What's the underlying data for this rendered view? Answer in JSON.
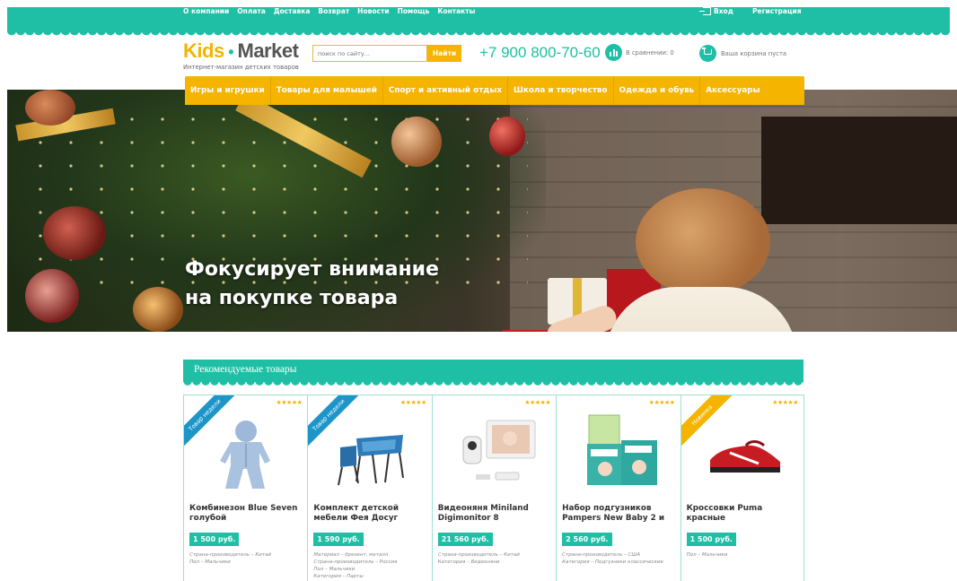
{
  "topbar": {
    "nav": [
      "О компании",
      "Оплата",
      "Доставка",
      "Возврат",
      "Новости",
      "Помощь",
      "Контакты"
    ],
    "login": "Вход",
    "register": "Регистрация"
  },
  "header": {
    "logo_kids": "Kids",
    "logo_market": "Market",
    "tagline": "Интернет-магазин детских товаров",
    "search_placeholder": "поиск по сайту...",
    "search_button": "Найти",
    "phone": "+7 900 800-70-60",
    "compare": "В сравнении: 0",
    "cart": "Ваша корзина пуста"
  },
  "categories": [
    "Игры и игрушки",
    "Товары для малышей",
    "Спорт и активный отдых",
    "Школа и творчество",
    "Одежда и обувь",
    "Аксессуары"
  ],
  "hero": {
    "line1": "Фокусирует внимание",
    "line2": "на покупке товара"
  },
  "recommended": {
    "title": "Рекомендуемые товары",
    "products": [
      {
        "badge": "Товар недели",
        "title": "Комбинезон Blue Seven голубой",
        "price": "1 500 руб.",
        "meta": "Страна-производитель – Китай\nПол – Мальчики"
      },
      {
        "badge": "Товар недели",
        "title": "Комплект детской мебели Фея Досуг",
        "price": "1 590 руб.",
        "meta": "Материал – брезент, металл\nСтрана-производитель – Россия\nПол – Мальчики\nКатегория – Парты"
      },
      {
        "badge": "",
        "title": "Видеоняня Miniland Digimonitor 8",
        "price": "21 560 руб.",
        "meta": "Страна-производитель – Китай\nКатегория – Видеоняни"
      },
      {
        "badge": "",
        "title": "Набор подгузников Pampers New Baby 2 и",
        "price": "2 560 руб.",
        "meta": "Страна-производитель – США\nКатегория – Подгузники классические"
      },
      {
        "badge": "Новинка",
        "title": "Кроссовки Puma красные",
        "price": "1 500 руб.",
        "meta": "Пол – Мальчики"
      }
    ],
    "stars": "★★★★★"
  },
  "colors": {
    "teal": "#1fbfa5",
    "yellow": "#f4b400",
    "blue_badge": "#1c95c9"
  }
}
